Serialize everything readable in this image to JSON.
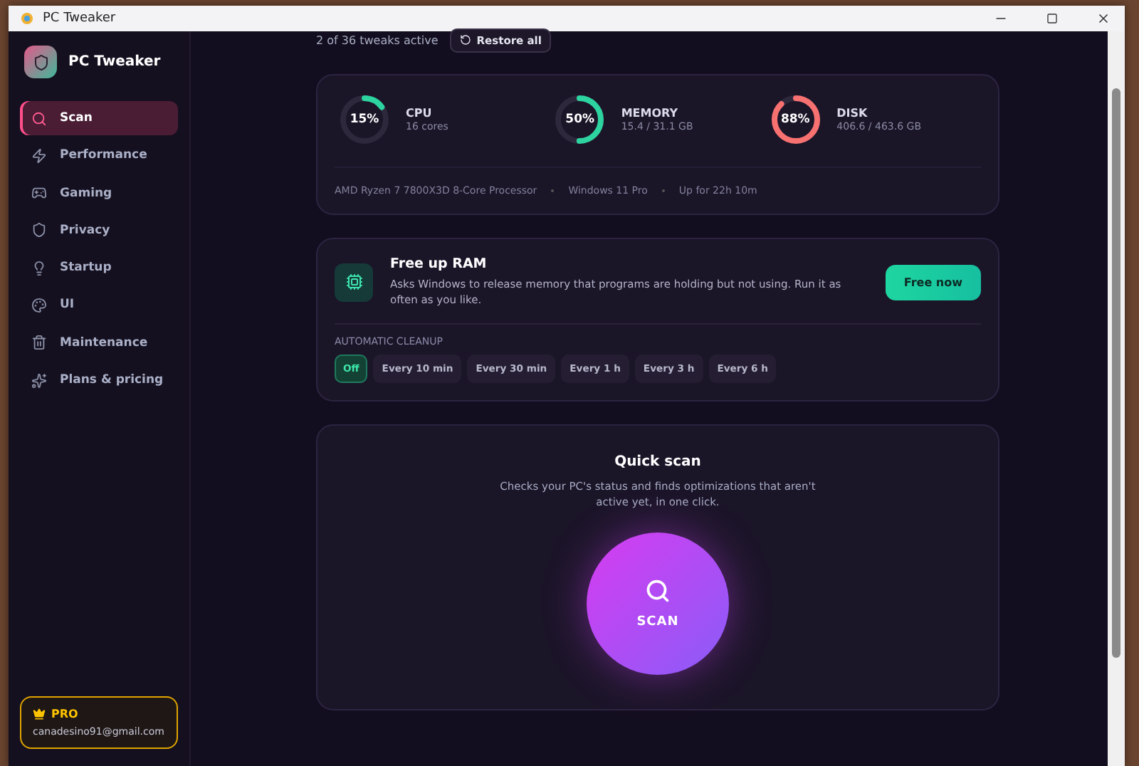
{
  "window": {
    "title": "PC Tweaker"
  },
  "sidebar": {
    "app_name": "PC Tweaker",
    "items": [
      {
        "label": "Scan",
        "selected": true
      },
      {
        "label": "Performance",
        "selected": false
      },
      {
        "label": "Gaming",
        "selected": false
      },
      {
        "label": "Privacy",
        "selected": false
      },
      {
        "label": "Startup",
        "selected": false
      },
      {
        "label": "UI",
        "selected": false
      },
      {
        "label": "Maintenance",
        "selected": false
      },
      {
        "label": "Plans & pricing",
        "selected": false
      }
    ],
    "plan": {
      "badge": "PRO",
      "email": "canadesino91@gmail.com"
    }
  },
  "header": {
    "status": "2 of 36 tweaks active",
    "restore_button": "Restore all"
  },
  "stats": {
    "meters": [
      {
        "value": "15%",
        "name": "CPU",
        "detail": "16 cores",
        "level": 0.15,
        "color": "#2dd4a0"
      },
      {
        "value": "50%",
        "name": "MEMORY",
        "detail": "15.4 / 31.1 GB",
        "level": 0.5,
        "color": "#2dd4a0"
      },
      {
        "value": "88%",
        "name": "DISK",
        "detail": "406.6 / 463.6 GB",
        "level": 0.88,
        "color": "#f87171"
      }
    ],
    "system_info": [
      "AMD Ryzen 7 7800X3D 8-Core Processor",
      "Windows 11 Pro",
      "Up for 22h 10m"
    ]
  },
  "free_ram": {
    "title": "Free up RAM",
    "description": "Asks Windows to release memory that programs are holding but not using. Run it as often as you like.",
    "button": "Free now",
    "cleanup_label": "AUTOMATIC CLEANUP",
    "options": [
      {
        "label": "Off",
        "selected": true
      },
      {
        "label": "Every 10 min",
        "selected": false
      },
      {
        "label": "Every 30 min",
        "selected": false
      },
      {
        "label": "Every 1 h",
        "selected": false
      },
      {
        "label": "Every 3 h",
        "selected": false
      },
      {
        "label": "Every 6 h",
        "selected": false
      }
    ]
  },
  "quick_scan": {
    "title": "Quick scan",
    "description": "Checks your PC's status and finds optimizations that aren't active yet, in one click.",
    "button": "SCAN"
  }
}
